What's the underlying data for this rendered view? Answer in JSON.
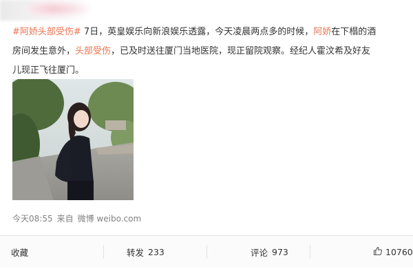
{
  "post": {
    "line1": {
      "tag": "#阿娇头部受伤#",
      "text1": " 7日，英皇娱乐向新浪娱乐透露，今天凌晨两点多的时候，",
      "mention": "阿娇",
      "text2": "在下榻的酒"
    },
    "line2": {
      "text1": "房间发生意外，",
      "mention": "头部受伤",
      "text2": "，已及时送往厦门当地医院，现正留院观察。经纪人霍汶希及好友"
    },
    "line3": {
      "text1": "儿现正飞往厦门。"
    }
  },
  "meta": {
    "time": "今天08:55",
    "source_prefix": "来自",
    "source": "微博 weibo.com"
  },
  "actions": {
    "favorite_label": "收藏",
    "repost_label": "转发",
    "repost_count": "233",
    "comment_label": "评论",
    "comment_count": "973",
    "like_count": "10760"
  },
  "colors": {
    "link": "#eb7350",
    "text": "#333333",
    "meta": "#808080"
  },
  "icons": {
    "like": "thumbs-up-icon"
  }
}
